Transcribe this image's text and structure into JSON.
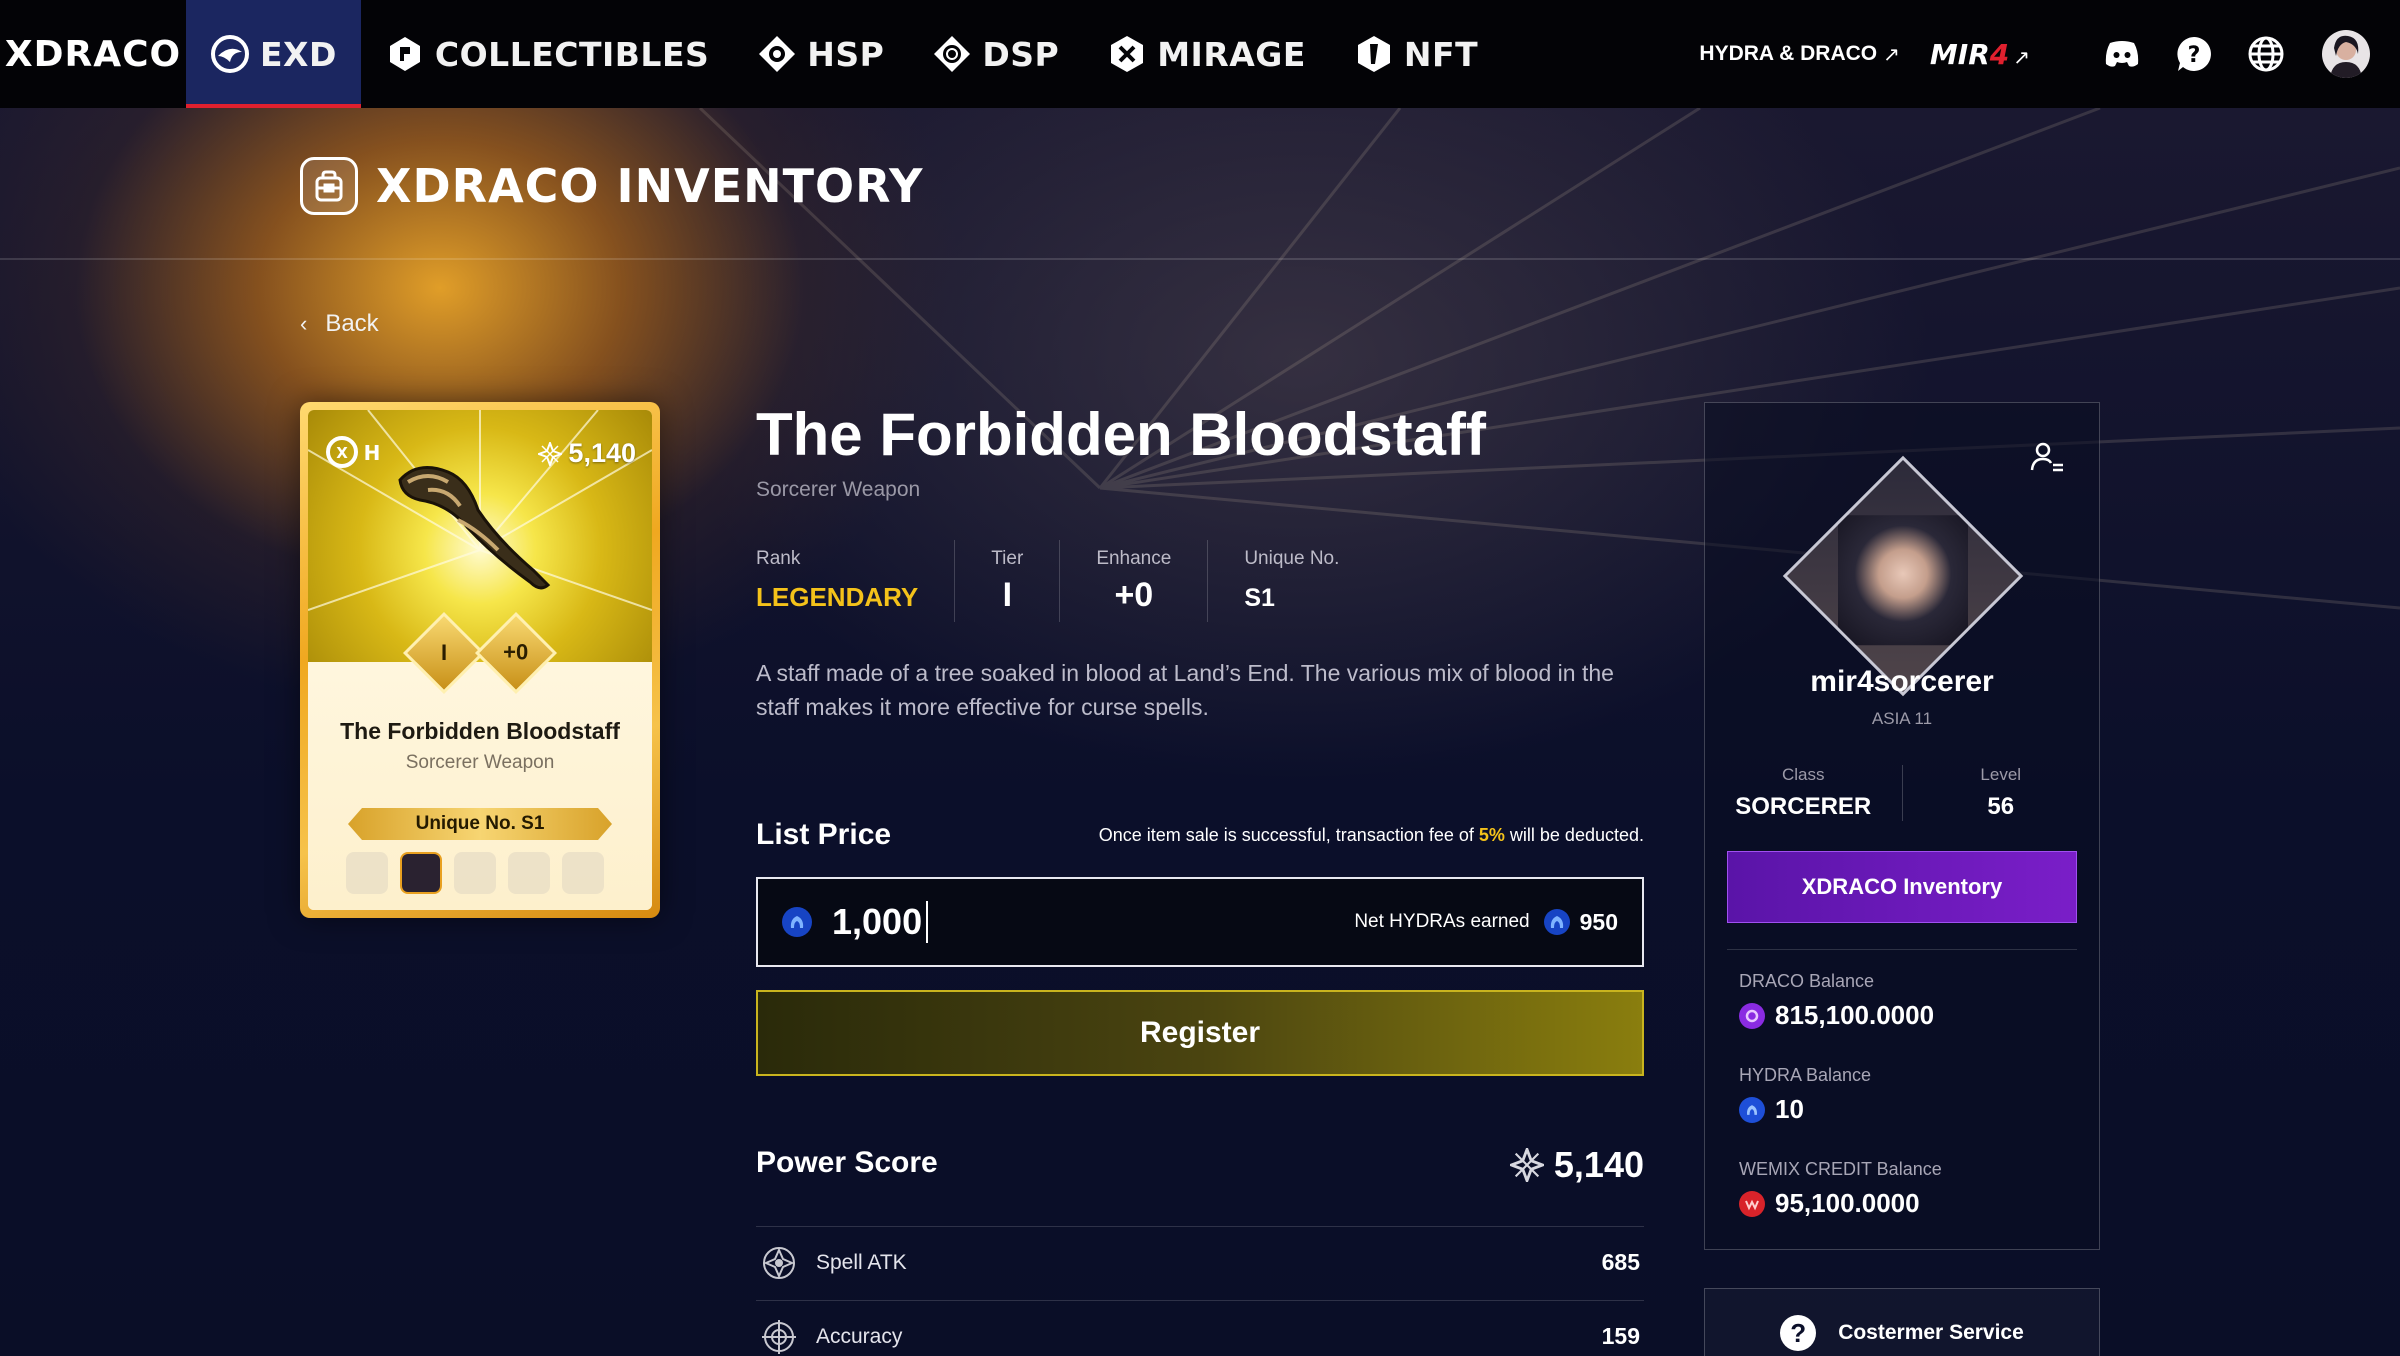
{
  "nav": {
    "brand": "XDRACO",
    "items": [
      {
        "label": "EXD",
        "icon": "exd-icon",
        "active": true
      },
      {
        "label": "COLLECTIBLES",
        "icon": "collectibles-icon"
      },
      {
        "label": "HSP",
        "icon": "hsp-icon"
      },
      {
        "label": "DSP",
        "icon": "dsp-icon"
      },
      {
        "label": "MIRAGE",
        "icon": "mirage-icon"
      },
      {
        "label": "NFT",
        "icon": "nft-icon"
      }
    ],
    "external_link": "HYDRA & DRACO",
    "arrow": "↗",
    "mir4_prefix": "MIR",
    "mir4_num": "4",
    "icons": [
      "discord-icon",
      "help-icon",
      "language-globe-icon",
      "user-avatar-icon"
    ]
  },
  "page": {
    "title": "XDRACO INVENTORY",
    "back_label": "Back"
  },
  "card": {
    "power": "5,140",
    "tier": "I",
    "enhance": "+0",
    "name": "The Forbidden Bloodstaff",
    "type": "Sorcerer Weapon",
    "unique": "Unique No. S1"
  },
  "item": {
    "name": "The Forbidden Bloodstaff",
    "type": "Sorcerer Weapon",
    "rank_label": "Rank",
    "rank": "LEGENDARY",
    "tier_label": "Tier",
    "tier": "I",
    "enhance_label": "Enhance",
    "enhance": "+0",
    "unique_label": "Unique No.",
    "unique": "S1",
    "description": "A staff made of a tree soaked in blood at Land’s End. The various mix of blood in the staff makes it more effective for curse spells."
  },
  "listing": {
    "label": "List Price",
    "fee_prefix": "Once item sale is successful, transaction fee of ",
    "fee_pct": "5%",
    "fee_suffix": " will be deducted.",
    "price": "1,000",
    "net_label": "Net HYDRAs earned",
    "net_value": "950",
    "register_label": "Register"
  },
  "power_score": {
    "label": "Power Score",
    "total": "5,140",
    "stats": [
      {
        "name": "Spell ATK",
        "value": "685"
      },
      {
        "name": "Accuracy",
        "value": "159"
      }
    ]
  },
  "profile": {
    "name": "mir4sorcerer",
    "server": "ASIA 11",
    "class_label": "Class",
    "class": "SORCERER",
    "level_label": "Level",
    "level": "56",
    "inventory_button": "XDRACO Inventory",
    "balances": [
      {
        "label": "DRACO Balance",
        "value": "815,100.0000",
        "color": "#8a2be2"
      },
      {
        "label": "HYDRA Balance",
        "value": "10",
        "color": "#1e4fd8"
      },
      {
        "label": "WEMIX CREDIT Balance",
        "value": "95,100.0000",
        "color": "#d8232a"
      }
    ],
    "customer_service": "Costermer Service"
  },
  "colors": {
    "accent_red": "#e0202e",
    "legendary_gold": "#f4c21a",
    "inventory_purple": "#6a18b8",
    "register_gold": "#c9b41e"
  }
}
